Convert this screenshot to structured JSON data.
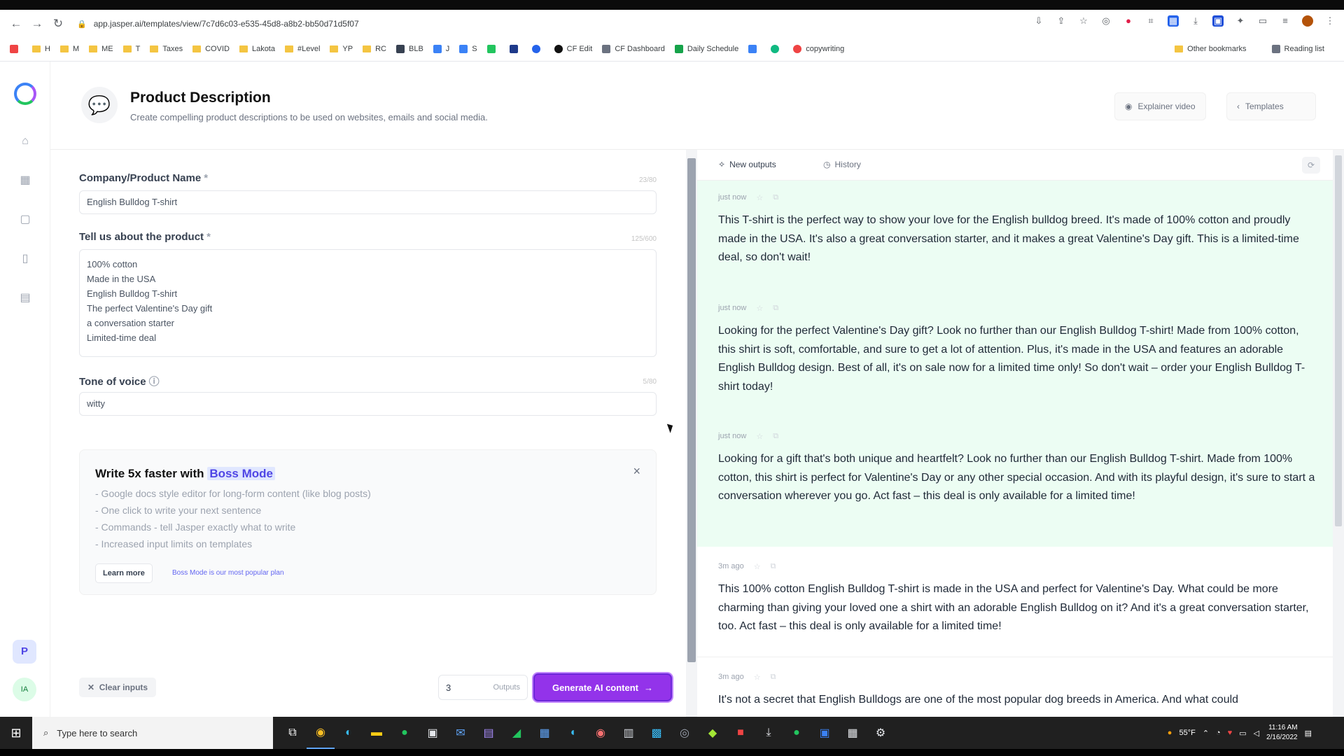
{
  "browser": {
    "url": "app.jasper.ai/templates/view/7c7d6c03-e535-45d8-a8b2-bb50d71d5f07",
    "bookmarks": [
      "H",
      "M",
      "ME",
      "T",
      "Taxes",
      "COVID",
      "Lakota",
      "#Level",
      "YP",
      "RC",
      "BLB",
      "J",
      "S",
      "",
      "",
      "",
      "CF Edit",
      "CF Dashboard",
      "Daily Schedule",
      "",
      "",
      "copywriting"
    ],
    "other_bookmarks": "Other bookmarks",
    "reading_list": "Reading list"
  },
  "header": {
    "title": "Product Description",
    "subtitle": "Create compelling product descriptions to be used on websites, emails and social media.",
    "explainer_label": "Explainer video",
    "templates_label": "Templates"
  },
  "form": {
    "company": {
      "label": "Company/Product Name",
      "required": "*",
      "count": "23/80",
      "value": "English Bulldog T-shirt"
    },
    "product": {
      "label": "Tell us about the product",
      "required": "*",
      "count": "125/600",
      "lines": [
        "100% cotton",
        "Made in the USA",
        "English Bulldog T-shirt",
        "The perfect Valentine's Day gift",
        "a conversation starter",
        "Limited-time deal"
      ]
    },
    "tone": {
      "label": "Tone of voice",
      "count": "5/80",
      "value": "witty"
    }
  },
  "boss": {
    "title_prefix": "Write 5x faster with",
    "title_highlight": "Boss Mode",
    "items": [
      "- Google docs style editor for long-form content (like blog posts)",
      "- One click to write your next sentence",
      "- Commands - tell Jasper exactly what to write",
      "- Increased input limits on templates"
    ],
    "learn_more": "Learn more",
    "popular": "Boss Mode is our most popular plan"
  },
  "footer": {
    "clear_label": "Clear inputs",
    "outputs_value": "3",
    "outputs_label": "Outputs",
    "generate_label": "Generate AI content"
  },
  "results": {
    "tab_new": "New outputs",
    "tab_history": "History",
    "outputs": [
      {
        "time": "just now",
        "text": "This T-shirt is the perfect way to show your love for the English bulldog breed. It's made of 100% cotton and proudly made in the USA. It's also a great conversation starter, and it makes a great Valentine's Day gift. This is a limited-time deal, so don't wait!"
      },
      {
        "time": "just now",
        "text": "Looking for the perfect Valentine's Day gift? Look no further than our English Bulldog T-shirt! Made from 100% cotton, this shirt is soft, comfortable, and sure to get a lot of attention. Plus, it's made in the USA and features an adorable English Bulldog design. Best of all, it's on sale now for a limited time only! So don't wait – order your English Bulldog T-shirt today!"
      },
      {
        "time": "just now",
        "text": "Looking for a gift that's both unique and heartfelt? Look no further than our English Bulldog T-shirt. Made from 100% cotton, this shirt is perfect for Valentine's Day or any other special occasion. And with its playful design, it's sure to start a conversation wherever you go. Act fast – this deal is only available for a limited time!"
      },
      {
        "time": "3m ago",
        "text": "This 100% cotton English Bulldog T-shirt is made in the USA and perfect for Valentine's Day. What could be more charming than giving your loved one a shirt with an adorable English Bulldog on it? And it's a great conversation starter, too. Act fast – this deal is only available for a limited time!"
      },
      {
        "time": "3m ago",
        "text": "It's not a secret that English Bulldogs are one of the most popular dog breeds in America. And what could"
      }
    ]
  },
  "sidebar": {
    "avatar_p": "P",
    "avatar_ia": "IA"
  },
  "taskbar": {
    "search_placeholder": "Type here to search",
    "weather": "55°F",
    "time": "11:16 AM",
    "date": "2/16/2022"
  },
  "colors": {
    "accent": "#9333ea",
    "new_output_bg": "#ecfdf3",
    "highlight": "#4f46e5"
  }
}
